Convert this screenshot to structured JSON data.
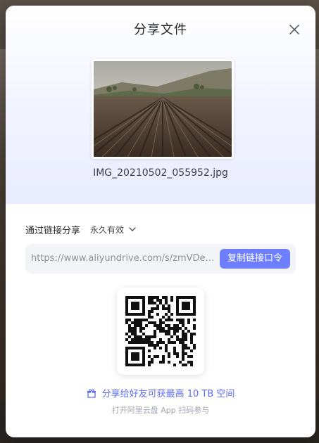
{
  "modal": {
    "title": "分享文件"
  },
  "file": {
    "name": "IMG_20210502_055952.jpg"
  },
  "share": {
    "label": "通过链接分享",
    "validity": "永久有效",
    "link": "https://www.aliyundrive.com/s/zmVDenu...",
    "copy_button": "复制链接口令"
  },
  "promo": {
    "text": "分享给好友可获最高 10 TB 空间",
    "subtext": "打开阿里云盘 App 扫码参与"
  },
  "icons": {
    "close": "close-icon",
    "chevron": "chevron-down-icon",
    "gift": "gift-icon",
    "qr": "qr-code"
  },
  "colors": {
    "accent": "#6d7fff",
    "promo_text": "#5b6cf0",
    "top_gradient": "#e9ecff"
  }
}
